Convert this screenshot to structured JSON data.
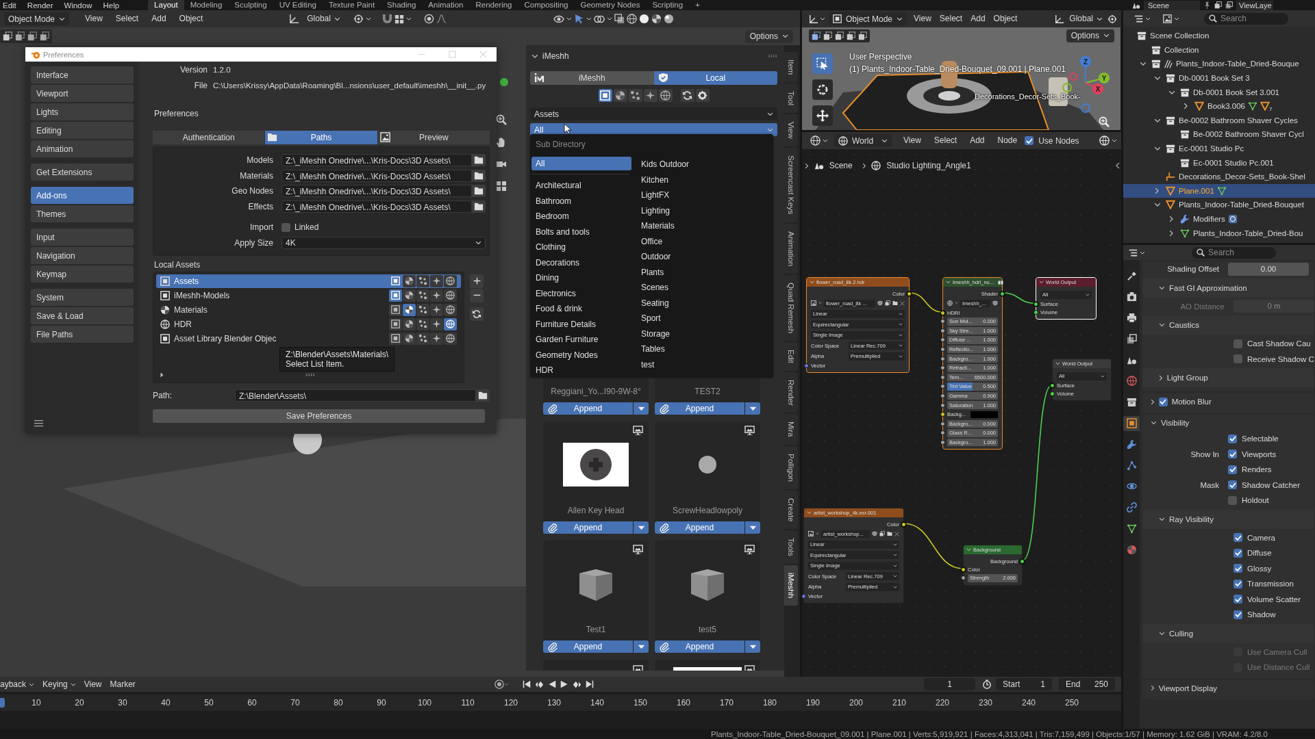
{
  "top_bar": {
    "menus": [
      "Edit",
      "Render",
      "Window",
      "Help"
    ],
    "workspaces": [
      {
        "label": "Layout",
        "selected": true
      },
      {
        "label": "Modeling",
        "selected": false
      },
      {
        "label": "Sculpting",
        "selected": false
      },
      {
        "label": "UV Editing",
        "selected": false
      },
      {
        "label": "Texture Paint",
        "selected": false
      },
      {
        "label": "Shading",
        "selected": false
      },
      {
        "label": "Animation",
        "selected": false
      },
      {
        "label": "Rendering",
        "selected": false
      },
      {
        "label": "Compositing",
        "selected": false
      },
      {
        "label": "Geometry Nodes",
        "selected": false
      },
      {
        "label": "Scripting",
        "selected": false
      }
    ],
    "add_workspace": "+",
    "scene": "Scene",
    "view_layer": "ViewLaye"
  },
  "viewport": {
    "mode": "Object Mode",
    "menus": [
      "View",
      "Select",
      "Add",
      "Object"
    ],
    "orientation": "Global",
    "options": "Options"
  },
  "preferences": {
    "title": "Preferences",
    "nav": [
      {
        "items": [
          {
            "label": "Interface",
            "selected": false
          },
          {
            "label": "Viewport",
            "selected": false
          },
          {
            "label": "Lights",
            "selected": false
          },
          {
            "label": "Editing",
            "selected": false
          },
          {
            "label": "Animation",
            "selected": false
          }
        ]
      },
      {
        "items": [
          {
            "label": "Get Extensions",
            "selected": false
          }
        ]
      },
      {
        "items": [
          {
            "label": "Add-ons",
            "selected": true
          },
          {
            "label": "Themes",
            "selected": false
          }
        ]
      },
      {
        "items": [
          {
            "label": "Input",
            "selected": false
          },
          {
            "label": "Navigation",
            "selected": false
          },
          {
            "label": "Keymap",
            "selected": false
          }
        ]
      },
      {
        "items": [
          {
            "label": "System",
            "selected": false
          },
          {
            "label": "Save & Load",
            "selected": false
          },
          {
            "label": "File Paths",
            "selected": false
          }
        ]
      }
    ],
    "info": [
      {
        "label": "Version",
        "value": "1.2.0"
      },
      {
        "label": "File",
        "value": "C:\\Users\\Krissy\\AppData\\Roaming\\Bl...nsions\\user_default\\imeshh\\__init__.py"
      }
    ],
    "section": "Preferences",
    "tabs": [
      {
        "label": "Authentication",
        "kind": "authentication",
        "selected": false
      },
      {
        "label": "Paths",
        "kind": "paths",
        "selected": true
      },
      {
        "label": "Preview",
        "kind": "preview",
        "selected": false
      }
    ],
    "paths": [
      {
        "label": "Models",
        "value": "Z:\\_iMeshh Onedrive\\...\\Kris-Docs\\3D Assets\\"
      },
      {
        "label": "Materials",
        "value": "Z:\\_iMeshh Onedrive\\...\\Kris-Docs\\3D Assets\\"
      },
      {
        "label": "Geo Nodes",
        "value": "Z:\\_iMeshh Onedrive\\...\\Kris-Docs\\3D Assets\\"
      },
      {
        "label": "Effects",
        "value": "Z:\\_iMeshh Onedrive\\...\\Kris-Docs\\3D Assets\\"
      }
    ],
    "import": {
      "label": "Import",
      "option": "Linked",
      "checked": false
    },
    "apply_size": {
      "label": "Apply Size",
      "value": "4K"
    },
    "local_assets": {
      "title": "Local Assets",
      "libraries": [
        {
          "name": "Assets",
          "kind": "object",
          "selected": true,
          "types": [
            {
              "kind": "model",
              "on": true
            },
            {
              "kind": "material",
              "on": false
            },
            {
              "kind": "particles",
              "on": false
            },
            {
              "kind": "effects",
              "on": false
            },
            {
              "kind": "hdr",
              "on": false
            }
          ]
        },
        {
          "name": "iMeshh-Models",
          "kind": "object",
          "selected": false,
          "types": [
            {
              "kind": "model",
              "on": true
            },
            {
              "kind": "material",
              "on": false
            },
            {
              "kind": "particles",
              "on": false
            },
            {
              "kind": "effects",
              "on": false
            },
            {
              "kind": "hdr",
              "on": false
            }
          ]
        },
        {
          "name": "Materials",
          "kind": "material",
          "selected": false,
          "types": [
            {
              "kind": "model",
              "on": false
            },
            {
              "kind": "material",
              "on": true
            },
            {
              "kind": "particles",
              "on": false
            },
            {
              "kind": "effects",
              "on": false
            },
            {
              "kind": "hdr",
              "on": false
            }
          ]
        },
        {
          "name": "HDR",
          "kind": "world",
          "selected": false,
          "types": [
            {
              "kind": "model",
              "on": false
            },
            {
              "kind": "material",
              "on": false
            },
            {
              "kind": "particles",
              "on": false
            },
            {
              "kind": "effects",
              "on": false
            },
            {
              "kind": "hdr",
              "on": true
            }
          ]
        },
        {
          "name": "Asset Library Blender Objec",
          "kind": "object",
          "selected": false,
          "types": [
            {
              "kind": "model",
              "on": false
            },
            {
              "kind": "material",
              "on": false
            },
            {
              "kind": "particles",
              "on": false
            },
            {
              "kind": "effects",
              "on": false
            },
            {
              "kind": "hdr",
              "on": false
            }
          ]
        }
      ],
      "tooltip": {
        "path": "Z:\\Blender\\Assets\\Materials\\",
        "hint": "Select List Item."
      }
    },
    "path": {
      "label": "Path:",
      "value": "Z:\\Blender\\Assets\\"
    },
    "save": "Save Preferences"
  },
  "sidebar": {
    "title": "iMeshh",
    "sources": [
      {
        "label": "iMeshh",
        "kind": "online",
        "selected": false
      },
      {
        "label": "Local",
        "kind": "local",
        "selected": true
      }
    ],
    "types": [
      {
        "kind": "model",
        "selected": true
      },
      {
        "kind": "material",
        "selected": false
      },
      {
        "kind": "particles",
        "selected": false
      },
      {
        "kind": "effects",
        "selected": false
      },
      {
        "kind": "hdr",
        "selected": false
      }
    ],
    "category": "Assets",
    "subdirectory": {
      "value": "All",
      "open": true
    },
    "menu": {
      "title": "Sub Directory",
      "columns": [
        {
          "items": [
            {
              "label": "All",
              "selected": true
            },
            {
              "label": "Architectural",
              "selected": false
            },
            {
              "label": "Bathroom",
              "selected": false
            },
            {
              "label": "Bedroom",
              "selected": false
            },
            {
              "label": "Bolts and tools",
              "selected": false
            },
            {
              "label": "Clothing",
              "selected": false
            },
            {
              "label": "Decorations",
              "selected": false
            },
            {
              "label": "Dining",
              "selected": false
            },
            {
              "label": "Electronics",
              "selected": false
            },
            {
              "label": "Food & drink",
              "selected": false
            },
            {
              "label": "Furniture Details",
              "selected": false
            },
            {
              "label": "Garden Furniture",
              "selected": false
            },
            {
              "label": "Geometry Nodes",
              "selected": false
            },
            {
              "label": "HDR",
              "selected": false
            }
          ]
        },
        {
          "items": [
            {
              "label": "Kids Outdoor",
              "selected": false
            },
            {
              "label": "Kitchen",
              "selected": false
            },
            {
              "label": "LightFX",
              "selected": false
            },
            {
              "label": "Lighting",
              "selected": false
            },
            {
              "label": "Materials",
              "selected": false
            },
            {
              "label": "Office",
              "selected": false
            },
            {
              "label": "Outdoor",
              "selected": false
            },
            {
              "label": "Plants",
              "selected": false
            },
            {
              "label": "Scenes",
              "selected": false
            },
            {
              "label": "Seating",
              "selected": false
            },
            {
              "label": "Sport",
              "selected": false
            },
            {
              "label": "Storage",
              "selected": false
            },
            {
              "label": "Tables",
              "selected": false
            },
            {
              "label": "test",
              "selected": false
            }
          ]
        }
      ]
    },
    "cards": [
      {
        "name": "Reggiani_Yo...I90-9W-8°",
        "kind": "covered",
        "action": "Append"
      },
      {
        "name": "TEST2",
        "kind": "covered",
        "action": "Append"
      },
      {
        "name": "Allen Key Head",
        "kind": "photo",
        "action": "Append"
      },
      {
        "name": "ScrewHeadlowpoly",
        "kind": "sphere",
        "action": "Append"
      },
      {
        "name": "Test1",
        "kind": "cube",
        "action": "Append"
      },
      {
        "name": "test5",
        "kind": "cube",
        "action": "Append"
      },
      {
        "kind": "blank"
      },
      {
        "kind": "photo"
      }
    ],
    "tabs": [
      {
        "label": "Item",
        "selected": false
      },
      {
        "label": "Tool",
        "selected": false
      },
      {
        "label": "View",
        "selected": false
      },
      {
        "label": "Screencast Keys",
        "selected": false
      },
      {
        "label": "Animation",
        "selected": false
      },
      {
        "label": "Quad Remesh",
        "selected": false
      },
      {
        "label": "Edit",
        "selected": false
      },
      {
        "label": "Render",
        "selected": false
      },
      {
        "label": "Mira",
        "selected": false
      },
      {
        "label": "Polligon",
        "selected": false
      },
      {
        "label": "Create",
        "selected": false
      },
      {
        "label": "Tools",
        "selected": false
      },
      {
        "label": "iMeshh",
        "selected": true
      }
    ]
  },
  "render_view": {
    "mode": "Object Mode",
    "menus": [
      "View",
      "Select",
      "Add",
      "Object"
    ],
    "orientation": "Global",
    "options": "Options",
    "view_name": "User Perspective",
    "object_info": "(1) Plants_Indoor-Table_Dried-Bouquet_09.001 | Plane.001",
    "object_label": "Decorations_Decor-Sets_Book-",
    "axes": [
      {
        "label": "Z",
        "color": "#3f7fd8"
      },
      {
        "label": "Y",
        "color": "#83bd2c"
      },
      {
        "label": "X",
        "color": "#e2405c"
      }
    ]
  },
  "node_editor": {
    "world": "World",
    "menus": [
      "View",
      "Select",
      "Add",
      "Node"
    ],
    "use_nodes": {
      "label": "Use Nodes",
      "checked": true
    },
    "breadcrumbs": [
      {
        "label": "Scene",
        "kind": "scene"
      },
      {
        "label": "Studio Lighting_Angle1",
        "kind": "world"
      }
    ],
    "nodes": [
      {
        "title": "flower_road_8k 2.hdr",
        "color": "#8f4d1d",
        "selected": true,
        "active": false,
        "rows": [
          {
            "kind": "output",
            "label": "Color",
            "socket": {
              "kind": "color",
              "linked": true
            }
          },
          {
            "kind": "selector",
            "value": "flower_road_8k ..."
          },
          {
            "kind": "dropdown",
            "value": "Linear"
          },
          {
            "kind": "dropdown",
            "value": "Equirectangular"
          },
          {
            "kind": "dropdown",
            "value": "Single Image"
          },
          {
            "kind": "dropdown",
            "label": "Color Space",
            "value": "Linear Rec.709"
          },
          {
            "kind": "dropdown",
            "label": "Alpha",
            "value": "Premultiplied"
          },
          {
            "kind": "input",
            "label": "Vector",
            "socket": {
              "kind": "vector",
              "linked": false
            }
          }
        ]
      },
      {
        "title": "Imeshh_hdri_no...",
        "color": "#2f4f2f",
        "selected": true,
        "active": false,
        "rows": [
          {
            "kind": "output",
            "label": "Shader",
            "socket": {
              "kind": "shader",
              "linked": true
            }
          },
          {
            "kind": "selector",
            "value": "Imeshh_..."
          },
          {
            "kind": "input",
            "label": "HDRI",
            "socket": {
              "kind": "color",
              "linked": true
            }
          },
          {
            "kind": "field",
            "label": "Sun Mul...",
            "value": "0.000",
            "socket": {
              "kind": "float",
              "linked": false
            }
          },
          {
            "kind": "field",
            "label": "Sky Stre...",
            "value": "1.000",
            "socket": {
              "kind": "float",
              "linked": false
            }
          },
          {
            "kind": "field",
            "label": "Diffuse ...",
            "value": "1.000",
            "socket": {
              "kind": "float",
              "linked": false
            }
          },
          {
            "kind": "field",
            "label": "Reflectio...",
            "value": "1.000",
            "socket": {
              "kind": "float",
              "linked": false
            }
          },
          {
            "kind": "field",
            "label": "Backgro...",
            "value": "1.000",
            "socket": {
              "kind": "float",
              "linked": false
            }
          },
          {
            "kind": "field",
            "label": "Refracti...",
            "value": "1.000",
            "socket": {
              "kind": "float",
              "linked": false
            }
          },
          {
            "kind": "field",
            "label": "Tem...",
            "value": "6500.000",
            "socket": {
              "kind": "float",
              "linked": false
            }
          },
          {
            "kind": "slider",
            "label": "Tint Value",
            "value": "0.500",
            "level": 0.5,
            "socket": {
              "kind": "float",
              "linked": false
            }
          },
          {
            "kind": "field",
            "label": "Gamma",
            "value": "0.900",
            "socket": {
              "kind": "float",
              "linked": false
            }
          },
          {
            "kind": "field",
            "label": "Saturation",
            "value": "1.000",
            "socket": {
              "kind": "float",
              "linked": false
            }
          },
          {
            "kind": "color",
            "label": "Backg...",
            "color": "#000000",
            "socket": {
              "kind": "color",
              "linked": false
            }
          },
          {
            "kind": "field",
            "label": "Backgro...",
            "value": "0.000",
            "socket": {
              "kind": "float",
              "linked": false
            }
          },
          {
            "kind": "field",
            "label": "Glass R...",
            "value": "0.000",
            "socket": {
              "kind": "float",
              "linked": false
            }
          },
          {
            "kind": "field",
            "label": "Backgro...",
            "value": "1.000",
            "socket": {
              "kind": "float",
              "linked": false
            }
          }
        ]
      },
      {
        "title": "World Output",
        "color": "#5b1e2c",
        "selected": true,
        "active": true,
        "rows": [
          {
            "kind": "dropdown",
            "value": "All"
          },
          {
            "kind": "input",
            "label": "Surface",
            "socket": {
              "kind": "shader",
              "linked": true
            }
          },
          {
            "kind": "input",
            "label": "Volume",
            "socket": {
              "kind": "shader",
              "linked": false
            }
          }
        ]
      },
      {
        "title": "World Output",
        "color": "#3b3b3b",
        "selected": false,
        "active": false,
        "rows": [
          {
            "kind": "dropdown",
            "value": "All"
          },
          {
            "kind": "input",
            "label": "Surface",
            "socket": {
              "kind": "shader",
              "linked": true
            }
          },
          {
            "kind": "input",
            "label": "Volume",
            "socket": {
              "kind": "shader",
              "linked": false
            }
          }
        ]
      },
      {
        "title": "artist_workshop_4k.exr.001",
        "color": "#8f4d1d",
        "selected": false,
        "active": false,
        "rows": [
          {
            "kind": "output",
            "label": "Color",
            "socket": {
              "kind": "color",
              "linked": true
            }
          },
          {
            "kind": "selector",
            "value": "artist_workshop..."
          },
          {
            "kind": "dropdown",
            "value": "Linear"
          },
          {
            "kind": "dropdown",
            "value": "Equirectangular"
          },
          {
            "kind": "dropdown",
            "value": "Single Image"
          },
          {
            "kind": "dropdown",
            "label": "Color Space",
            "value": "Linear Rec.709"
          },
          {
            "kind": "dropdown",
            "label": "Alpha",
            "value": "Premultiplied"
          },
          {
            "kind": "input",
            "label": "Vector",
            "socket": {
              "kind": "vector",
              "linked": false
            }
          }
        ]
      },
      {
        "title": "Background",
        "color": "#2b6a2f",
        "selected": false,
        "active": false,
        "rows": [
          {
            "kind": "output",
            "label": "Background",
            "socket": {
              "kind": "shader",
              "linked": true
            }
          },
          {
            "kind": "input",
            "label": "Color",
            "socket": {
              "kind": "color",
              "linked": true
            }
          },
          {
            "kind": "field",
            "label": "Strength",
            "value": "2.000",
            "socket": {
              "kind": "float",
              "linked": false
            }
          }
        ]
      }
    ]
  },
  "outliner": {
    "search": {
      "placeholder": "Search"
    },
    "tree": [
      {
        "label": "Scene Collection",
        "kind": "collection",
        "selected": false,
        "children": [
          {
            "label": "Collection",
            "kind": "collection",
            "selected": false
          },
          {
            "label": "Plants_Indoor-Table_Dried-Bouque",
            "kind": "collection",
            "extra": {
              "kind": "lineart"
            },
            "selected": false,
            "expanded": true,
            "children": [
              {
                "label": "Db-0001 Book Set 3",
                "kind": "collection",
                "selected": false,
                "expanded": true,
                "children": [
                  {
                    "label": "Db-0001 Book Set 3.001",
                    "kind": "collection",
                    "selected": false,
                    "expanded": true,
                    "children": [
                      {
                        "label": "Book3.006",
                        "kind": "object",
                        "selected": false,
                        "expanded": false,
                        "badges": [
                          {
                            "kind": "mesh"
                          },
                          {
                            "kind": "object",
                            "count": "7"
                          }
                        ]
                      }
                    ]
                  }
                ]
              },
              {
                "label": "Be-0002 Bathroom Shaver Cycles",
                "kind": "collection",
                "selected": false,
                "expanded": true,
                "children": [
                  {
                    "label": "Be-0002 Bathroom Shaver Cycl",
                    "kind": "collection",
                    "selected": false
                  }
                ]
              },
              {
                "label": "Ec-0001 Studio Pc",
                "kind": "collection",
                "selected": false,
                "expanded": true,
                "children": [
                  {
                    "label": "Ec-0001 Studio Pc.001",
                    "kind": "collection",
                    "selected": false
                  }
                ]
              },
              {
                "label": "Decorations_Decor-Sets_Book-Shel",
                "kind": "empty",
                "selected": false
              },
              {
                "label": "Plane.001",
                "kind": "object",
                "selected": true,
                "expanded": false,
                "badges": [
                  {
                    "kind": "mesh"
                  }
                ]
              },
              {
                "label": "Plants_Indoor-Table_Dried-Bouquet",
                "kind": "object",
                "selected": false,
                "expanded": true,
                "children": [
                  {
                    "label": "Modifiers",
                    "kind": "modifiers",
                    "selected": false,
                    "expanded": false,
                    "badges": [
                      {
                        "kind": "modifier"
                      }
                    ]
                  },
                  {
                    "label": "Plants_Indoor-Table_Dried-Bou",
                    "kind": "mesh",
                    "selected": false,
                    "expanded": false
                  }
                ]
              }
            ]
          }
        ]
      }
    ]
  },
  "properties": {
    "search": {
      "placeholder": "Search"
    },
    "tabs": [
      {
        "kind": "tool",
        "selected": false
      },
      {
        "kind": "render",
        "selected": false
      },
      {
        "kind": "output",
        "selected": false
      },
      {
        "kind": "view_layer",
        "selected": false
      },
      {
        "kind": "scene",
        "selected": false
      },
      {
        "kind": "world",
        "selected": false
      },
      {
        "kind": "collection",
        "selected": false
      },
      {
        "kind": "object",
        "selected": true
      },
      {
        "kind": "modifiers",
        "selected": false
      },
      {
        "kind": "particles",
        "selected": false
      },
      {
        "kind": "physics",
        "selected": false
      },
      {
        "kind": "constraints",
        "selected": false
      },
      {
        "kind": "data",
        "selected": false
      },
      {
        "kind": "material",
        "selected": false
      }
    ],
    "content": [
      {
        "kind": "group",
        "children": [
          {
            "kind": "field",
            "label": "Shading Offset",
            "value": "0.00",
            "disabled": false
          },
          {
            "kind": "panel",
            "title": "Fast GI Approximation",
            "expanded": true,
            "children": [
              {
                "kind": "field",
                "label": "AO Distance",
                "value": "0 m",
                "disabled": true
              }
            ]
          },
          {
            "kind": "panel",
            "title": "Caustics",
            "expanded": true,
            "children": [
              {
                "kind": "check",
                "label": "Cast Shadow Cau",
                "checked": false,
                "disabled": false
              },
              {
                "kind": "check",
                "label": "Receive Shadow C",
                "checked": false,
                "disabled": false
              }
            ]
          },
          {
            "kind": "panel",
            "title": "Light Group",
            "expanded": false
          }
        ]
      },
      {
        "kind": "panel",
        "title": "Motion Blur",
        "expanded": false,
        "checked": true
      },
      {
        "kind": "panel",
        "title": "Visibility",
        "expanded": true,
        "children": [
          {
            "kind": "check",
            "label": "Selectable",
            "checked": true,
            "disabled": false
          },
          {
            "kind": "check",
            "heading": "Show In",
            "label": "Viewports",
            "checked": true,
            "disabled": false
          },
          {
            "kind": "check",
            "label": "Renders",
            "checked": true,
            "disabled": false
          },
          {
            "kind": "check",
            "heading": "Mask",
            "label": "Shadow Catcher",
            "checked": true,
            "disabled": false
          },
          {
            "kind": "check",
            "label": "Holdout",
            "checked": false,
            "disabled": false
          },
          {
            "kind": "panel",
            "title": "Ray Visibility",
            "expanded": true,
            "children": [
              {
                "kind": "check",
                "label": "Camera",
                "checked": true,
                "disabled": false
              },
              {
                "kind": "check",
                "label": "Diffuse",
                "checked": true,
                "disabled": false
              },
              {
                "kind": "check",
                "label": "Glossy",
                "checked": true,
                "disabled": false
              },
              {
                "kind": "check",
                "label": "Transmission",
                "checked": true,
                "disabled": false
              },
              {
                "kind": "check",
                "label": "Volume Scatter",
                "checked": true,
                "disabled": false
              },
              {
                "kind": "check",
                "label": "Shadow",
                "checked": true,
                "disabled": false
              }
            ]
          },
          {
            "kind": "panel",
            "title": "Culling",
            "expanded": true,
            "children": [
              {
                "kind": "check",
                "label": "Use Camera Cull",
                "checked": false,
                "disabled": true
              },
              {
                "kind": "check",
                "label": "Use Distance Cull",
                "checked": false,
                "disabled": true
              }
            ]
          }
        ]
      },
      {
        "kind": "panel",
        "title": "Viewport Display",
        "expanded": false
      }
    ]
  },
  "timeline": {
    "menus": [
      {
        "label": "ayback",
        "dropdown": true
      },
      {
        "label": "Keying",
        "dropdown": true
      },
      {
        "label": "View",
        "dropdown": false
      },
      {
        "label": "Marker",
        "dropdown": false
      }
    ],
    "current_frame": "1",
    "start": {
      "label": "Start",
      "value": "1"
    },
    "end": {
      "label": "End",
      "value": "250"
    },
    "ruler": [
      "10",
      "20",
      "30",
      "40",
      "50",
      "60",
      "70",
      "80",
      "90",
      "100",
      "110",
      "120",
      "130",
      "140",
      "150",
      "160",
      "170",
      "180",
      "190",
      "200",
      "210",
      "220",
      "230",
      "240",
      "250"
    ]
  },
  "status_bar": {
    "text": "Plants_Indoor-Table_Dried-Bouquet_09.001 | Plane.001 | Verts:5,919,921 | Faces:4,313,041 | Tris:7,159,499 | Objects:1/57 | Memory: 1.62 GiB | VRAM: 4.2/8.0"
  }
}
